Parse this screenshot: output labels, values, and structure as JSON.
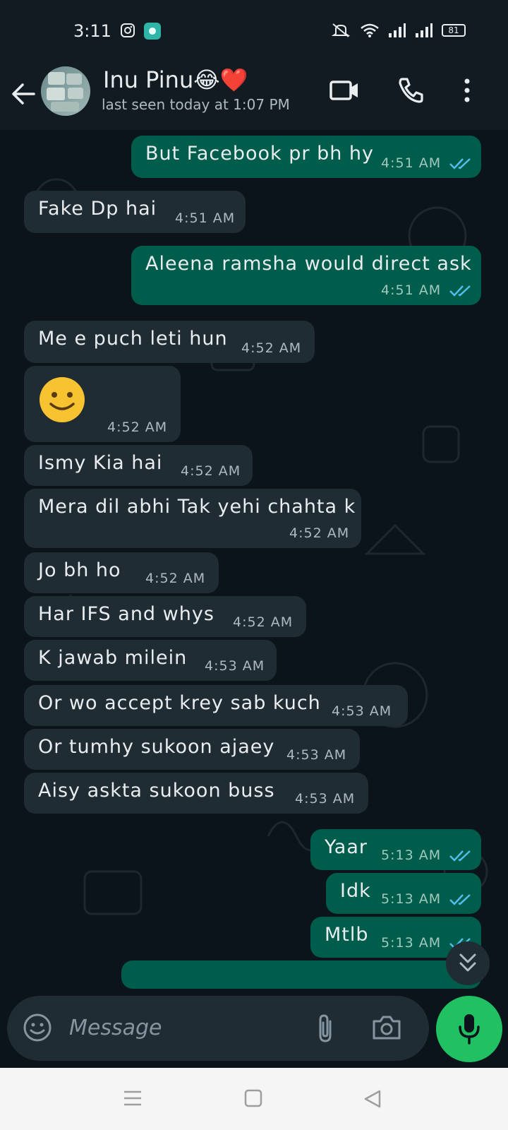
{
  "status_bar": {
    "time": "3:11",
    "battery": "81",
    "icons": [
      "instagram-icon",
      "app-icon",
      "mute-icon",
      "wifi-icon",
      "signal-icon",
      "signal-icon",
      "battery-icon"
    ]
  },
  "header": {
    "contact_name": "Inu Pinu😂❤️",
    "last_seen": "last seen today at 1:07 PM",
    "icons": [
      "back-arrow-icon",
      "video-call-icon",
      "phone-call-icon",
      "more-options-icon"
    ]
  },
  "messages": [
    {
      "dir": "out",
      "text": "But Facebook pr bh hy",
      "time": "4:51 AM",
      "read": true
    },
    {
      "dir": "in",
      "text": "Fake Dp hai",
      "time": "4:51 AM"
    },
    {
      "dir": "out",
      "text": "Aleena ramsha would direct ask",
      "time": "4:51 AM",
      "read": true
    },
    {
      "dir": "in",
      "text": "Me e puch leti hun",
      "time": "4:52 AM"
    },
    {
      "dir": "in",
      "text": "🙂",
      "time": "4:52 AM"
    },
    {
      "dir": "in",
      "text": "Ismy Kia hai",
      "time": "4:52 AM"
    },
    {
      "dir": "in",
      "text": "Mera dil abhi Tak yehi chahta k",
      "time": "4:52 AM"
    },
    {
      "dir": "in",
      "text": "Jo bh ho",
      "time": "4:52 AM"
    },
    {
      "dir": "in",
      "text": "Har IFS and whys",
      "time": "4:52 AM"
    },
    {
      "dir": "in",
      "text": "K jawab milein",
      "time": "4:53 AM"
    },
    {
      "dir": "in",
      "text": "Or wo accept krey sab kuch",
      "time": "4:53 AM"
    },
    {
      "dir": "in",
      "text": "Or tumhy sukoon ajaey",
      "time": "4:53 AM"
    },
    {
      "dir": "in",
      "text": "Aisy askta sukoon buss",
      "time": "4:53 AM"
    },
    {
      "dir": "out",
      "text": "Yaar",
      "time": "5:13 AM",
      "read": true
    },
    {
      "dir": "out",
      "text": "Idk",
      "time": "5:13 AM",
      "read": true
    },
    {
      "dir": "out",
      "text": "Mtlb",
      "time": "5:13 AM",
      "read": true
    }
  ],
  "composer": {
    "placeholder": "Message",
    "icons": [
      "emoji-icon",
      "attach-icon",
      "camera-icon",
      "mic-icon"
    ]
  },
  "colors": {
    "bg": "#0b141a",
    "bar": "#111b21",
    "incoming": "#202c33",
    "outgoing": "#005c4b",
    "accent": "#21c063",
    "read_tick": "#53bdeb"
  }
}
